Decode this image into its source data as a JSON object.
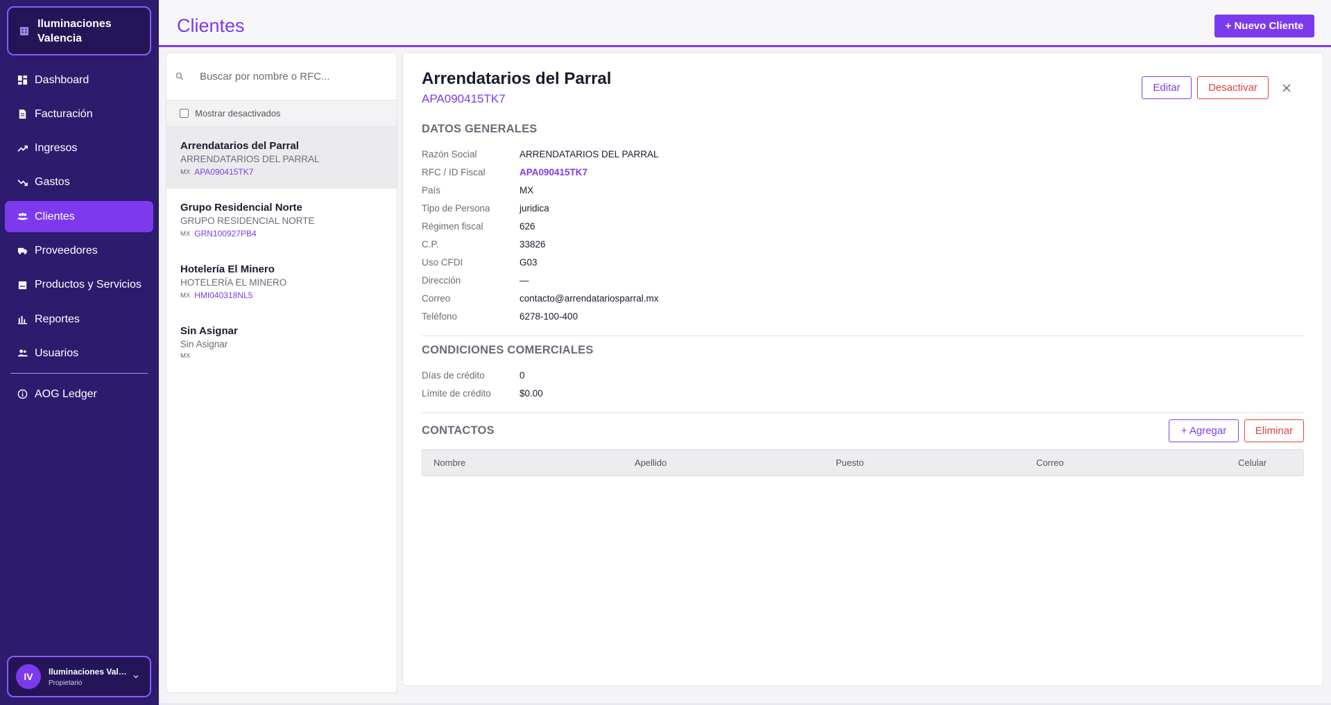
{
  "sidebar": {
    "brand": "Iluminaciones Valencia",
    "items": [
      {
        "label": "Dashboard",
        "icon": "dashboard-icon"
      },
      {
        "label": "Facturación",
        "icon": "document-icon"
      },
      {
        "label": "Ingresos",
        "icon": "trend-up-icon"
      },
      {
        "label": "Gastos",
        "icon": "trend-down-icon"
      },
      {
        "label": "Clientes",
        "icon": "people-icon",
        "active": true
      },
      {
        "label": "Proveedores",
        "icon": "truck-icon"
      },
      {
        "label": "Productos y Servicios",
        "icon": "box-icon"
      },
      {
        "label": "Reportes",
        "icon": "bar-chart-icon"
      },
      {
        "label": "Usuarios",
        "icon": "users-icon"
      }
    ],
    "extra": {
      "label": "AOG Ledger",
      "icon": "info-icon"
    },
    "user": {
      "initials": "IV",
      "name": "Iluminaciones Valencia",
      "role": "Propietario"
    }
  },
  "header": {
    "title": "Clientes",
    "new_button": "+ Nuevo Cliente"
  },
  "list": {
    "search_placeholder": "Buscar por nombre o RFC...",
    "show_inactive": "Mostrar desactivados",
    "clients": [
      {
        "name": "Arrendatarios del Parral",
        "legal": "ARRENDATARIOS DEL PARRAL",
        "country": "MX",
        "rfc": "APA090415TK7"
      },
      {
        "name": "Grupo Residencial Norte",
        "legal": "GRUPO RESIDENCIAL NORTE",
        "country": "MX",
        "rfc": "GRN100927PB4"
      },
      {
        "name": "Hotelería El Minero",
        "legal": "HOTELERÍA EL MINERO",
        "country": "MX",
        "rfc": "HMI040318NL5"
      },
      {
        "name": "Sin Asignar",
        "legal": "Sin Asignar",
        "country": "MX",
        "rfc": ""
      }
    ]
  },
  "detail": {
    "name": "Arrendatarios del Parral",
    "rfc": "APA090415TK7",
    "edit": "Editar",
    "deactivate": "Desactivar",
    "general_title": "DATOS GENERALES",
    "general": [
      {
        "label": "Razón Social",
        "value": "ARRENDATARIOS DEL PARRAL"
      },
      {
        "label": "RFC / ID Fiscal",
        "value": "APA090415TK7"
      },
      {
        "label": "País",
        "value": "MX"
      },
      {
        "label": "Tipo de Persona",
        "value": "juridica"
      },
      {
        "label": "Régimen fiscal",
        "value": "626"
      },
      {
        "label": "C.P.",
        "value": "33826"
      },
      {
        "label": "Uso CFDI",
        "value": "G03"
      },
      {
        "label": "Dirección",
        "value": "—"
      },
      {
        "label": "Correo",
        "value": "contacto@arrendatariosparral.mx"
      },
      {
        "label": "Teléfono",
        "value": "6278-100-400"
      }
    ],
    "commercial_title": "CONDICIONES COMERCIALES",
    "commercial": [
      {
        "label": "Días de crédito",
        "value": "0"
      },
      {
        "label": "Límite de crédito",
        "value": "$0.00"
      }
    ],
    "contacts_title": "CONTACTOS",
    "add_contact": "+ Agregar",
    "delete_contact": "Eliminar",
    "contact_columns": [
      "Nombre",
      "Apellido",
      "Puesto",
      "Correo",
      "Celular"
    ]
  }
}
